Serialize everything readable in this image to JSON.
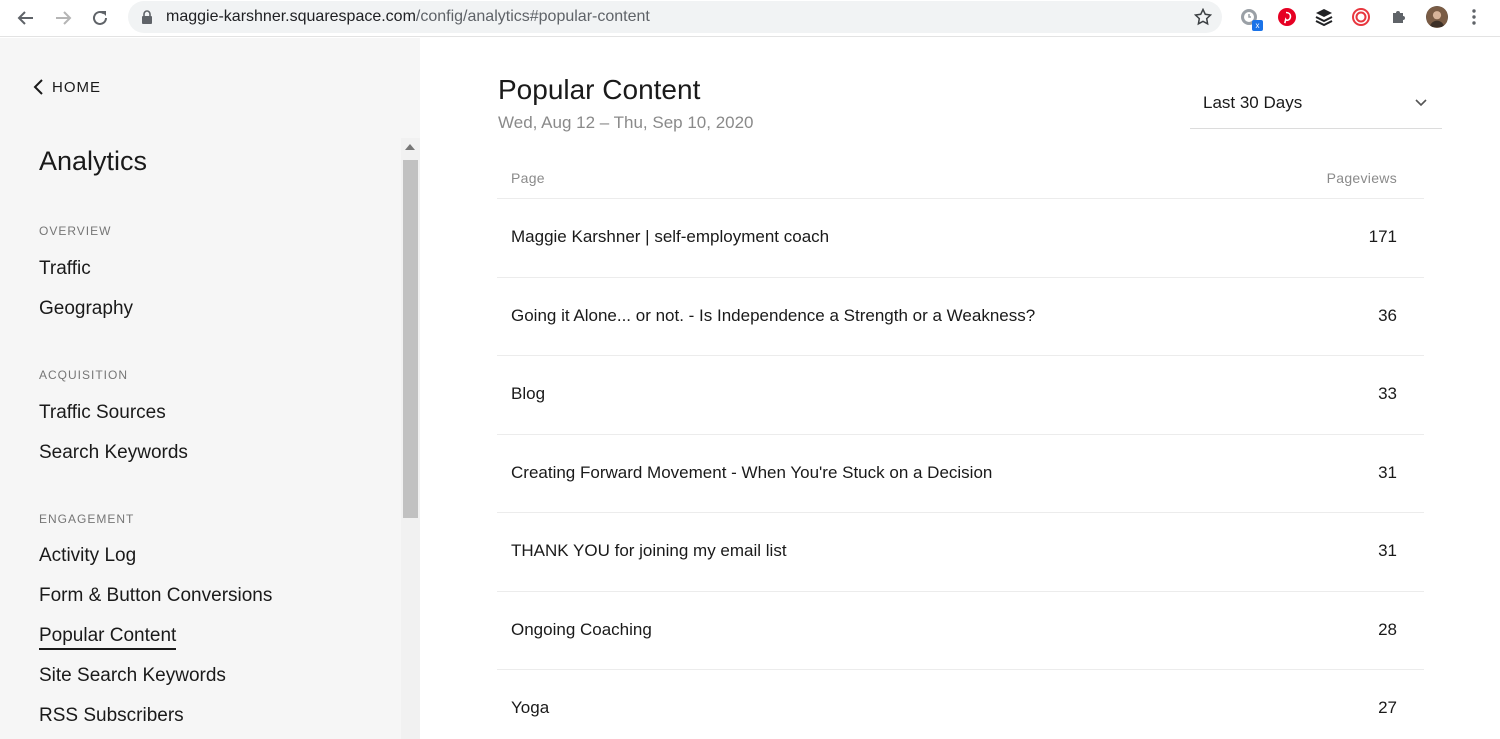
{
  "browser": {
    "url_host": "maggie-karshner.squarespace.com",
    "url_path": "/config/analytics#popular-content",
    "extension_badge": "x"
  },
  "sidebar": {
    "home_label": "HOME",
    "title": "Analytics",
    "sections": [
      {
        "label": "OVERVIEW",
        "items": [
          "Traffic",
          "Geography"
        ]
      },
      {
        "label": "ACQUISITION",
        "items": [
          "Traffic Sources",
          "Search Keywords"
        ]
      },
      {
        "label": "ENGAGEMENT",
        "items": [
          "Activity Log",
          "Form & Button Conversions",
          "Popular Content",
          "Site Search Keywords",
          "RSS Subscribers"
        ]
      }
    ],
    "active_item": "Popular Content"
  },
  "main": {
    "title": "Popular Content",
    "date_range": "Wed, Aug 12 – Thu, Sep 10, 2020",
    "period_select": "Last 30 Days",
    "table": {
      "columns": [
        "Page",
        "Pageviews"
      ],
      "rows": [
        {
          "page": "Maggie Karshner | self-employment coach",
          "views": "171"
        },
        {
          "page": "Going it Alone... or not. - Is Independence a Strength or a Weakness?",
          "views": "36"
        },
        {
          "page": "Blog",
          "views": "33"
        },
        {
          "page": "Creating Forward Movement - When You're Stuck on a Decision",
          "views": "31"
        },
        {
          "page": "THANK YOU for joining my email list",
          "views": "31"
        },
        {
          "page": "Ongoing Coaching",
          "views": "28"
        },
        {
          "page": "Yoga",
          "views": "27"
        }
      ]
    }
  },
  "colors": {
    "sidebar_bg": "#f6f6f6",
    "text": "#1a1a1a",
    "muted": "#8a8a8a",
    "pinterest": "#e60023",
    "lastpass_like": "#e8373f"
  }
}
